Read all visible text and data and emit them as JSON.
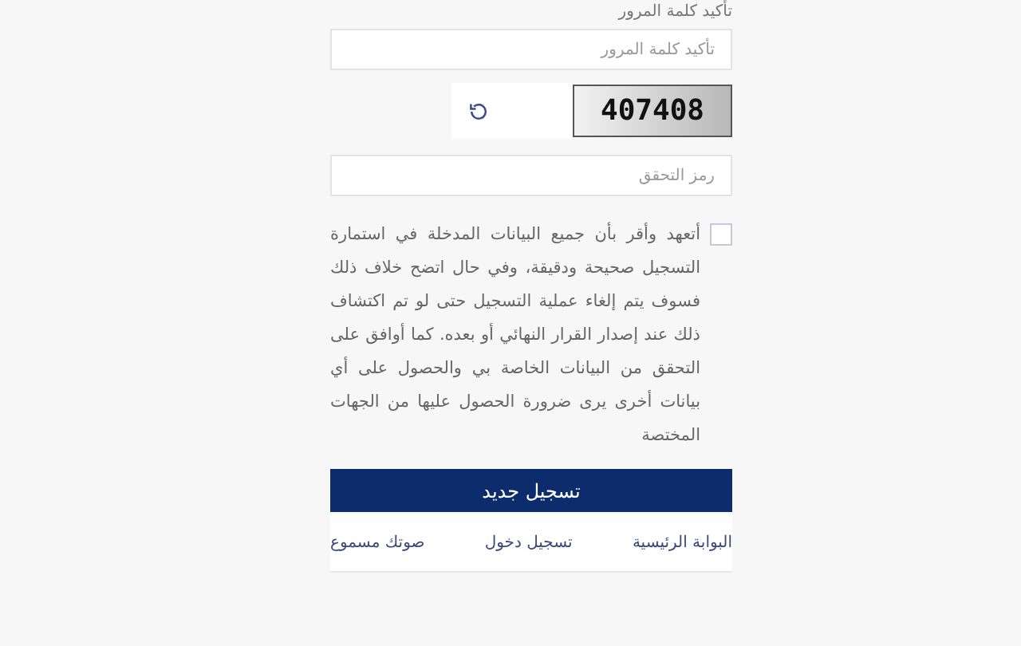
{
  "confirm_password": {
    "label": "تأكيد كلمة المرور",
    "placeholder": "تأكيد كلمة المرور"
  },
  "captcha": {
    "code": "407408"
  },
  "verification": {
    "placeholder": "رمز التحقق"
  },
  "agreement": {
    "checked": false,
    "text": "أتعهد وأقر بأن جميع البيانات المدخلة في استمارة التسجيل صحيحة ودقيقة، وفي حال اتضح خلاف ذلك فسوف يتم إلغاء عملية التسجيل حتى لو تم اكتشاف ذلك عند إصدار القرار النهائي أو بعده. كما أوافق على التحقق من البيانات الخاصة بي والحصول على أي بيانات أخرى يرى ضرورة الحصول عليها من الجهات المختصة"
  },
  "submit_button": "تسجيل جديد",
  "links": [
    "البوابة الرئيسية",
    "تسجيل دخول",
    "صوتك مسموع"
  ]
}
